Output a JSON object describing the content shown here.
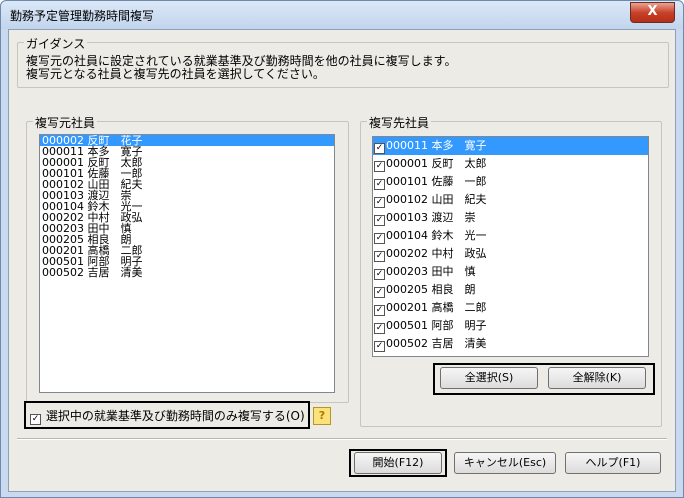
{
  "window": {
    "title": "勤務予定管理勤務時間複写",
    "close_label": "X"
  },
  "guidance": {
    "legend": "ガイダンス",
    "line1": "複写元の社員に設定されている就業基準及び勤務時間を他の社員に複写します。",
    "line2": "複写元となる社員と複写先の社員を選択してください。"
  },
  "source": {
    "legend": "複写元社員",
    "items": [
      "000002 反町　花子",
      "000011 本多　寛子",
      "000001 反町　太郎",
      "000101 佐藤　一郎",
      "000102 山田　紀夫",
      "000103 渡辺　崇",
      "000104 鈴木　光一",
      "000202 中村　政弘",
      "000203 田中　慎",
      "000205 相良　朗",
      "000201 高橋　二郎",
      "000501 阿部　明子",
      "000502 吉居　清美"
    ]
  },
  "target": {
    "legend": "複写先社員",
    "items": [
      "000011 本多　寛子",
      "000001 反町　太郎",
      "000101 佐藤　一郎",
      "000102 山田　紀夫",
      "000103 渡辺　崇",
      "000104 鈴木　光一",
      "000202 中村　政弘",
      "000203 田中　慎",
      "000205 相良　朗",
      "000201 高橋　二郎",
      "000501 阿部　明子",
      "000502 吉居　清美"
    ],
    "select_all": "全選択(S)",
    "deselect_all": "全解除(K)"
  },
  "option": {
    "label": "選択中の就業基準及び勤務時間のみ複写する(O)",
    "help": "?"
  },
  "footer": {
    "start": "開始(F12)",
    "cancel": "キャンセル(Esc)",
    "help": "ヘルプ(F1)"
  }
}
